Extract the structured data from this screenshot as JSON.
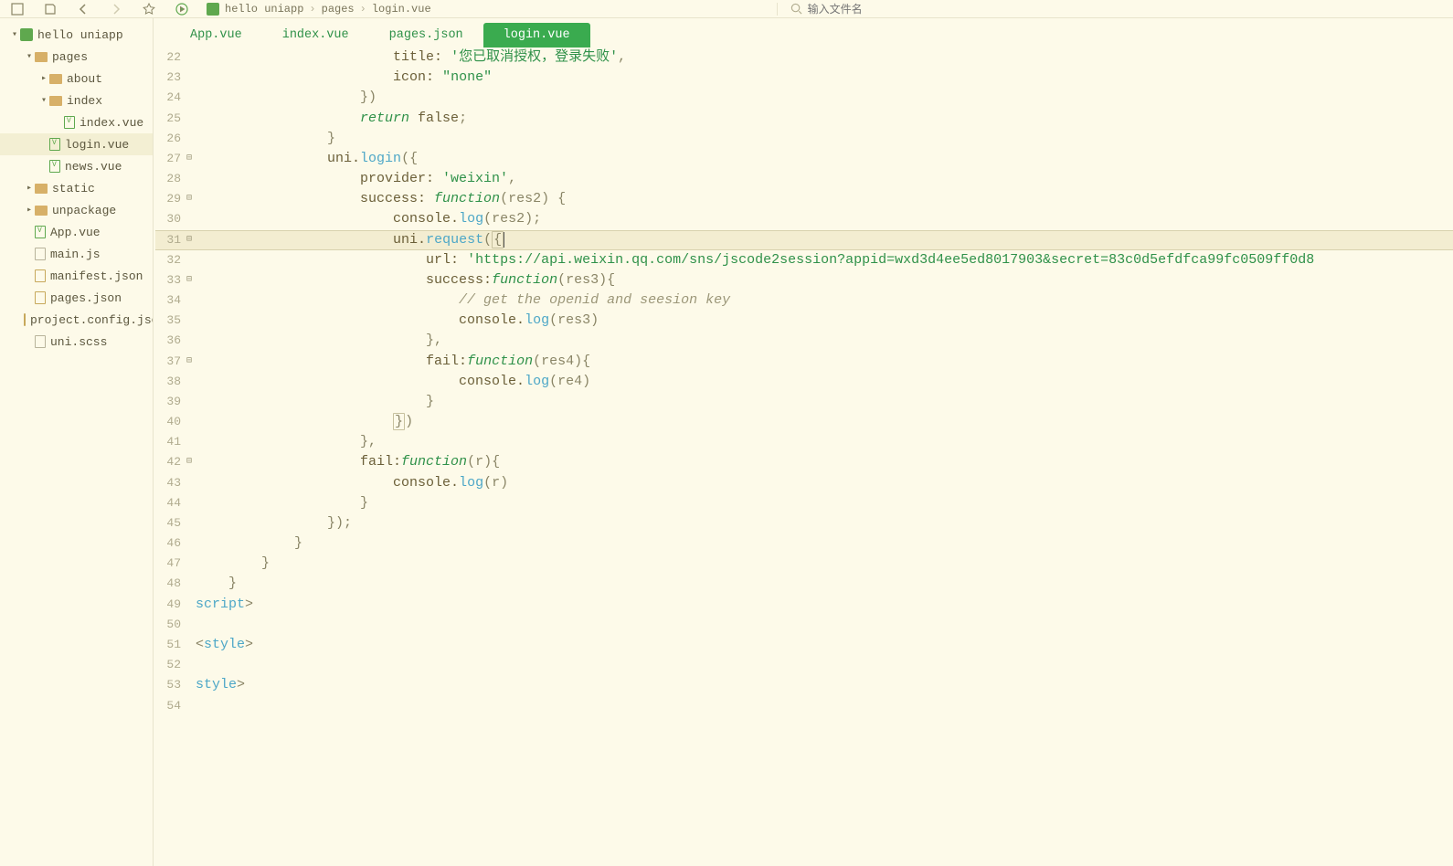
{
  "toolbar": {
    "breadcrumb": [
      "hello uniapp",
      "pages",
      "login.vue"
    ],
    "search_placeholder": "输入文件名"
  },
  "tree": {
    "project": "hello uniapp",
    "pages": "pages",
    "about": "about",
    "index_folder": "index",
    "index_vue": "index.vue",
    "login_vue": "login.vue",
    "news_vue": "news.vue",
    "static": "static",
    "unpackage": "unpackage",
    "app_vue": "App.vue",
    "main_js": "main.js",
    "manifest_json": "manifest.json",
    "pages_json": "pages.json",
    "project_config_json": "project.config.json",
    "uni_scss": "uni.scss"
  },
  "tabs": {
    "t0": "App.vue",
    "t1": "index.vue",
    "t2": "pages.json",
    "t3": "login.vue"
  },
  "lines": {
    "start": 22,
    "end": 54,
    "fold_lines": [
      27,
      29,
      31,
      33,
      37,
      42
    ],
    "highlight_line": 31
  },
  "code": {
    "l22_a": "title: ",
    "l22_b": "'您已取消授权，登录失败'",
    "l22_c": ",",
    "l23_a": "icon: ",
    "l23_b": "\"none\"",
    "l24": "})",
    "l25_a": "return",
    "l25_b": " false",
    "l25_c": ";",
    "l26": "}",
    "l27_a": "uni.",
    "l27_b": "login",
    "l27_c": "({",
    "l28_a": "provider: ",
    "l28_b": "'weixin'",
    "l28_c": ",",
    "l29_a": "success: ",
    "l29_b": "function",
    "l29_c": "(res2) {",
    "l30_a": "console.",
    "l30_b": "log",
    "l30_c": "(res2);",
    "l31_a": "uni.",
    "l31_b": "request",
    "l31_c": "(",
    "l31_d": "{",
    "l32_a": "url: ",
    "l32_b": "'https://api.weixin.qq.com/sns/jscode2session?appid=wxd3d4ee5ed8017903&secret=83c0d5efdfca99fc0509ff0d8",
    "l33_a": "success:",
    "l33_b": "function",
    "l33_c": "(res3){",
    "l34": "// get the openid and seesion key",
    "l35_a": "console.",
    "l35_b": "log",
    "l35_c": "(res3)",
    "l36": "},",
    "l37_a": "fail:",
    "l37_b": "function",
    "l37_c": "(res4){",
    "l38_a": "console.",
    "l38_b": "log",
    "l38_c": "(re4)",
    "l39": "}",
    "l40_a": "}",
    "l40_b": ")",
    "l41": "},",
    "l42_a": "fail:",
    "l42_b": "function",
    "l42_c": "(r){",
    "l43_a": "console.",
    "l43_b": "log",
    "l43_c": "(r)",
    "l44": "}",
    "l45": "});",
    "l46": "}",
    "l47": "}",
    "l48": "}",
    "l49_a": "</",
    "l49_b": "script",
    "l49_c": ">",
    "l51_a": "<",
    "l51_b": "style",
    "l51_c": ">",
    "l53_a": "</",
    "l53_b": "style",
    "l53_c": ">"
  }
}
